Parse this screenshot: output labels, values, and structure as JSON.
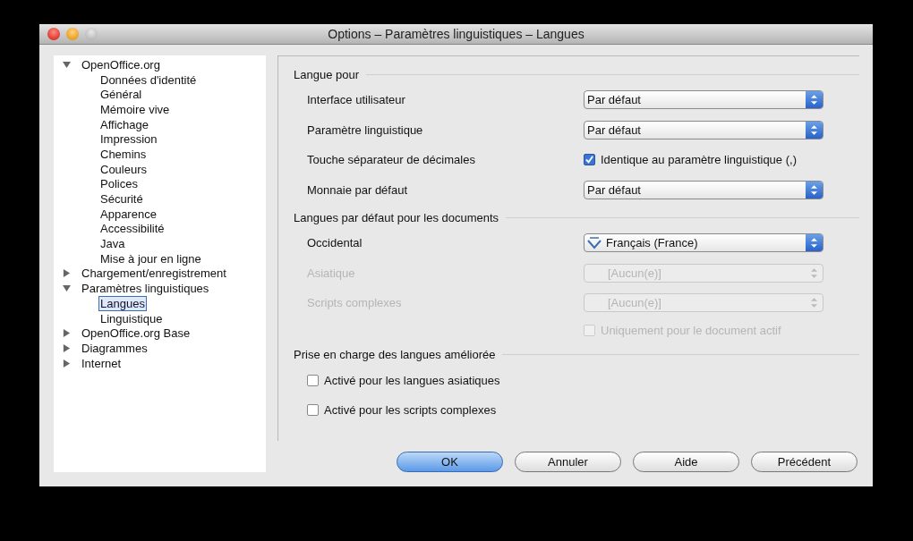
{
  "window": {
    "title": "Options – Paramètres linguistiques – Langues"
  },
  "tree": [
    {
      "label": "OpenOffice.org",
      "expanded": true,
      "selected": false,
      "children": [
        {
          "label": "Données d'identité",
          "selected": false
        },
        {
          "label": "Général",
          "selected": false
        },
        {
          "label": "Mémoire vive",
          "selected": false
        },
        {
          "label": "Affichage",
          "selected": false
        },
        {
          "label": "Impression",
          "selected": false
        },
        {
          "label": "Chemins",
          "selected": false
        },
        {
          "label": "Couleurs",
          "selected": false
        },
        {
          "label": "Polices",
          "selected": false
        },
        {
          "label": "Sécurité",
          "selected": false
        },
        {
          "label": "Apparence",
          "selected": false
        },
        {
          "label": "Accessibilité",
          "selected": false
        },
        {
          "label": "Java",
          "selected": false
        },
        {
          "label": "Mise à jour en ligne",
          "selected": false
        }
      ]
    },
    {
      "label": "Chargement/enregistrement",
      "expanded": false,
      "selected": false
    },
    {
      "label": "Paramètres linguistiques",
      "expanded": true,
      "selected": false,
      "children": [
        {
          "label": "Langues",
          "selected": true
        },
        {
          "label": "Linguistique",
          "selected": false
        }
      ]
    },
    {
      "label": "OpenOffice.org Base",
      "expanded": false,
      "selected": false
    },
    {
      "label": "Diagrammes",
      "expanded": false,
      "selected": false
    },
    {
      "label": "Internet",
      "expanded": false,
      "selected": false
    }
  ],
  "sections": [
    {
      "title": "Langue pour",
      "rows": [
        {
          "kind": "select",
          "label": "Interface utilisateur",
          "value": "Par défaut",
          "disabled": false,
          "spellcheck": false
        },
        {
          "kind": "select",
          "label": "Paramètre linguistique",
          "value": "Par défaut",
          "disabled": false,
          "spellcheck": false
        },
        {
          "kind": "label-checkbox",
          "label": "Touche séparateur de décimales",
          "option": "Identique au paramètre linguistique (,)",
          "checked": true,
          "disabled": false
        },
        {
          "kind": "select",
          "label": "Monnaie par défaut",
          "value": "Par défaut",
          "disabled": false,
          "spellcheck": false
        }
      ]
    },
    {
      "title": "Langues par défaut pour les documents",
      "rows": [
        {
          "kind": "select",
          "label": "Occidental",
          "value": "Français (France)",
          "disabled": false,
          "spellcheck": true
        },
        {
          "kind": "select",
          "label": "Asiatique",
          "value": "[Aucun(e)]",
          "disabled": true,
          "spellcheck": false
        },
        {
          "kind": "select",
          "label": "Scripts complexes",
          "value": "[Aucun(e)]",
          "disabled": true,
          "spellcheck": false
        },
        {
          "kind": "aside-checkbox",
          "option": "Uniquement pour le document actif",
          "checked": false,
          "disabled": true
        }
      ]
    },
    {
      "title": "Prise en charge des langues améliorée",
      "rows": [
        {
          "kind": "checkbox",
          "option": "Activé pour les langues asiatiques",
          "checked": false,
          "disabled": false
        },
        {
          "kind": "checkbox",
          "option": "Activé pour les scripts complexes",
          "checked": false,
          "disabled": false
        }
      ]
    }
  ],
  "buttons": [
    {
      "label": "OK",
      "default": true
    },
    {
      "label": "Annuler",
      "default": false
    },
    {
      "label": "Aide",
      "default": false
    },
    {
      "label": "Précédent",
      "default": false
    }
  ]
}
